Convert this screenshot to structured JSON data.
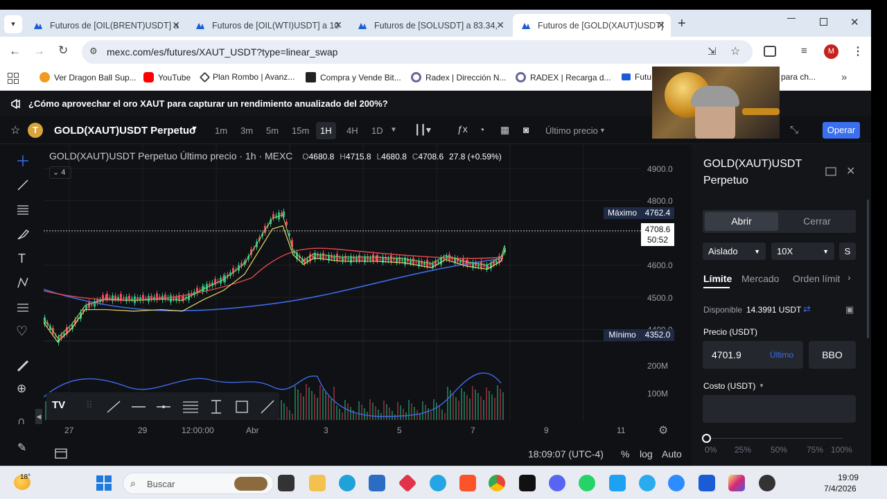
{
  "browser": {
    "tabs": [
      {
        "title": "Futuros de [OIL(BRENT)USDT] a",
        "active": false
      },
      {
        "title": "Futuros de [OIL(WTI)USDT] a 10",
        "active": false
      },
      {
        "title": "Futuros de [SOLUSDT] a 83.34, ",
        "active": false
      },
      {
        "title": "Futuros de [GOLD(XAUT)USDT]",
        "active": true
      }
    ],
    "url": "mexc.com/es/futures/XAUT_USDT?type=linear_swap",
    "profile_initial": "M",
    "bookmarks": [
      {
        "label": "Ver Dragon Ball Sup...",
        "color": "#f29a1f"
      },
      {
        "label": "YouTube",
        "color": "#ff0000"
      },
      {
        "label": "Plan Rombo | Avanz...",
        "color": "#444444"
      },
      {
        "label": "Compra y Vende Bit...",
        "color": "#222222"
      },
      {
        "label": "Radex | Dirección N...",
        "color": "#666699"
      },
      {
        "label": "RADEX | Recarga d...",
        "color": "#666699"
      },
      {
        "label": "Futu",
        "color": "#1a5bd6"
      },
      {
        "label": "para ch...",
        "color": "#ffffff"
      }
    ]
  },
  "banner": {
    "text": "¿Cómo aprovechar el oro XAUT para capturar un rendimiento anualizado del 200%?"
  },
  "header": {
    "symbol": "GOLD(XAUT)USDT Perpetuo",
    "timeframes": [
      "1m",
      "3m",
      "5m",
      "15m",
      "1H",
      "4H",
      "1D"
    ],
    "active_timeframe": "1H",
    "price_type": "Último precio",
    "trade_button": "Operar"
  },
  "chart": {
    "legend_title": "GOLD(XAUT)USDT Perpetuo Último precio · 1h · MEXC",
    "open_label": "O",
    "open": "4680.8",
    "high_label": "H",
    "high": "4715.8",
    "low_label": "L",
    "low": "4680.8",
    "close_label": "C",
    "close": "4708.6",
    "change": "27.8 (+0.59%)",
    "indicator_count": "4",
    "max_label": "Máximo",
    "max_value": "4762.4",
    "min_label": "Mínimo",
    "min_value": "4352.0",
    "last_price": "4708.6",
    "countdown": "50:52",
    "price_ticks": [
      "4900.0",
      "4800.0",
      "4700.0",
      "4600.0",
      "4500.0",
      "4400.0"
    ],
    "volume_ticks": [
      "200M",
      "100M"
    ],
    "time_ticks": [
      "27",
      "29",
      "12:00:00",
      "Abr",
      "3",
      "5",
      "7",
      "9",
      "11"
    ],
    "clock": "18:09:07 (UTC-4)",
    "scale_buttons": [
      "%",
      "log",
      "Auto"
    ]
  },
  "panel": {
    "title": "GOLD(XAUT)USDT Perpetuo",
    "open_tab": "Abrir",
    "close_tab": "Cerrar",
    "margin_mode": "Aislado",
    "leverage": "10X",
    "side_short": "S",
    "order_types": [
      "Límite",
      "Mercado",
      "Orden límit"
    ],
    "available_label": "Disponible",
    "available_value": "14.3991 USDT",
    "price_label": "Precio (USDT)",
    "price_value": "4701.9",
    "price_mode": "Último",
    "bbo": "BBO",
    "cost_label": "Costo (USDT)",
    "slider_marks": [
      "0%",
      "25%",
      "50%",
      "75%",
      "100%"
    ]
  },
  "taskbar": {
    "weather": "18°",
    "search_placeholder": "Buscar",
    "time": "19:09",
    "date": "7/4/2026"
  },
  "colors": {
    "accent": "#3a6ff0",
    "up": "#2ebd85",
    "down": "#f6465d",
    "ma_blue": "#3f6be8",
    "ma_red": "#e5494e",
    "ma_yellow": "#e8d86b",
    "ma_green": "#7fd46b"
  }
}
